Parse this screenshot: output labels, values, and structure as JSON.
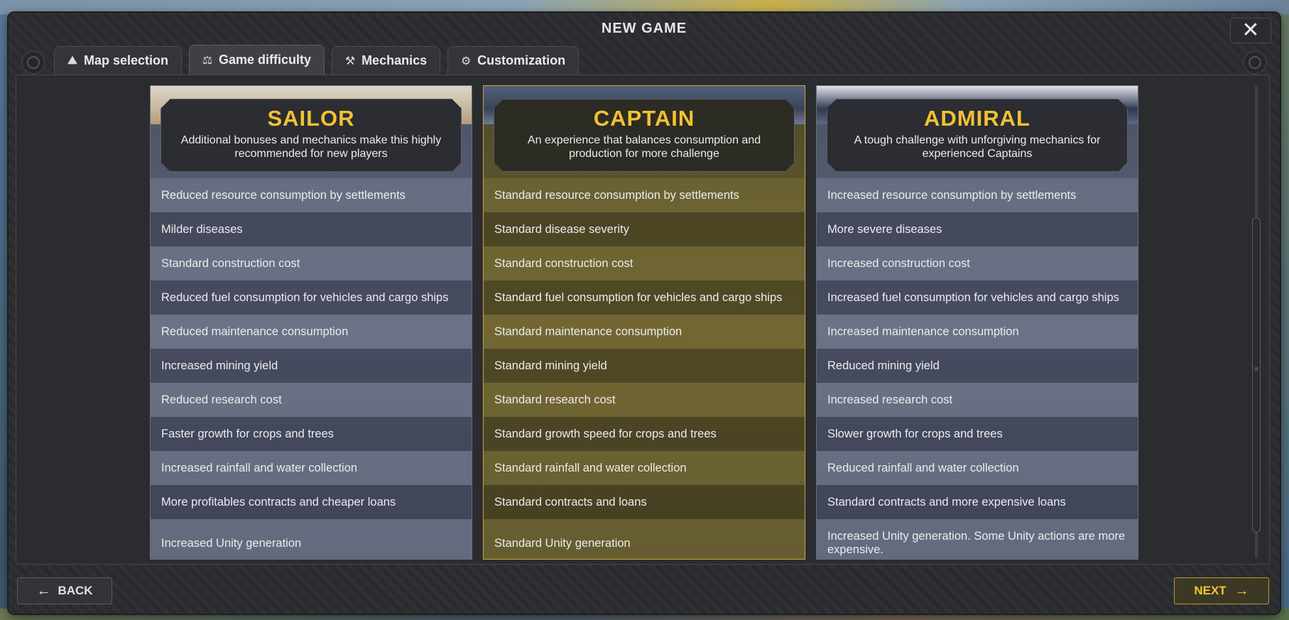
{
  "window": {
    "title": "NEW GAME",
    "close_label": "✕"
  },
  "tabs": [
    {
      "label": "Map selection",
      "icon": "map-pin-icon"
    },
    {
      "label": "Game difficulty",
      "icon": "balance-scale-icon",
      "active": true
    },
    {
      "label": "Mechanics",
      "icon": "hammer-icon"
    },
    {
      "label": "Customization",
      "icon": "gears-icon"
    }
  ],
  "difficulties": [
    {
      "title": "SAILOR",
      "description": "Additional bonuses and mechanics make this highly recommended for new players",
      "rows": [
        "Reduced resource consumption by settlements",
        "Milder diseases",
        "Standard construction cost",
        "Reduced fuel consumption for vehicles and cargo ships",
        "Reduced maintenance consumption",
        "Increased mining yield",
        "Reduced research cost",
        "Faster growth for crops and trees",
        "Increased rainfall and water collection",
        "More profitables contracts and cheaper loans",
        "Increased Unity generation"
      ]
    },
    {
      "title": "CAPTAIN",
      "description": "An experience that balances consumption and production for more challenge",
      "selected": true,
      "rows": [
        "Standard resource consumption by settlements",
        "Standard disease severity",
        "Standard construction cost",
        "Standard fuel consumption for vehicles and cargo ships",
        "Standard maintenance consumption",
        "Standard mining yield",
        "Standard research cost",
        "Standard growth speed for crops and trees",
        "Standard rainfall and water collection",
        "Standard contracts and loans",
        "Standard Unity generation"
      ]
    },
    {
      "title": "ADMIRAL",
      "description": "A tough challenge with unforgiving mechanics for experienced Captains",
      "rows": [
        "Increased resource consumption by settlements",
        "More severe diseases",
        "Increased construction cost",
        "Increased fuel consumption for vehicles and cargo ships",
        "Increased maintenance consumption",
        "Reduced mining yield",
        "Increased research cost",
        "Slower growth for crops and trees",
        "Reduced rainfall and water collection",
        "Standard contracts and more expensive loans",
        "Increased Unity generation. Some Unity actions are more expensive."
      ]
    }
  ],
  "footer": {
    "back_label": "BACK",
    "next_label": "NEXT"
  },
  "colors": {
    "accent": "#f2c230",
    "panel": "#2b2c30"
  }
}
